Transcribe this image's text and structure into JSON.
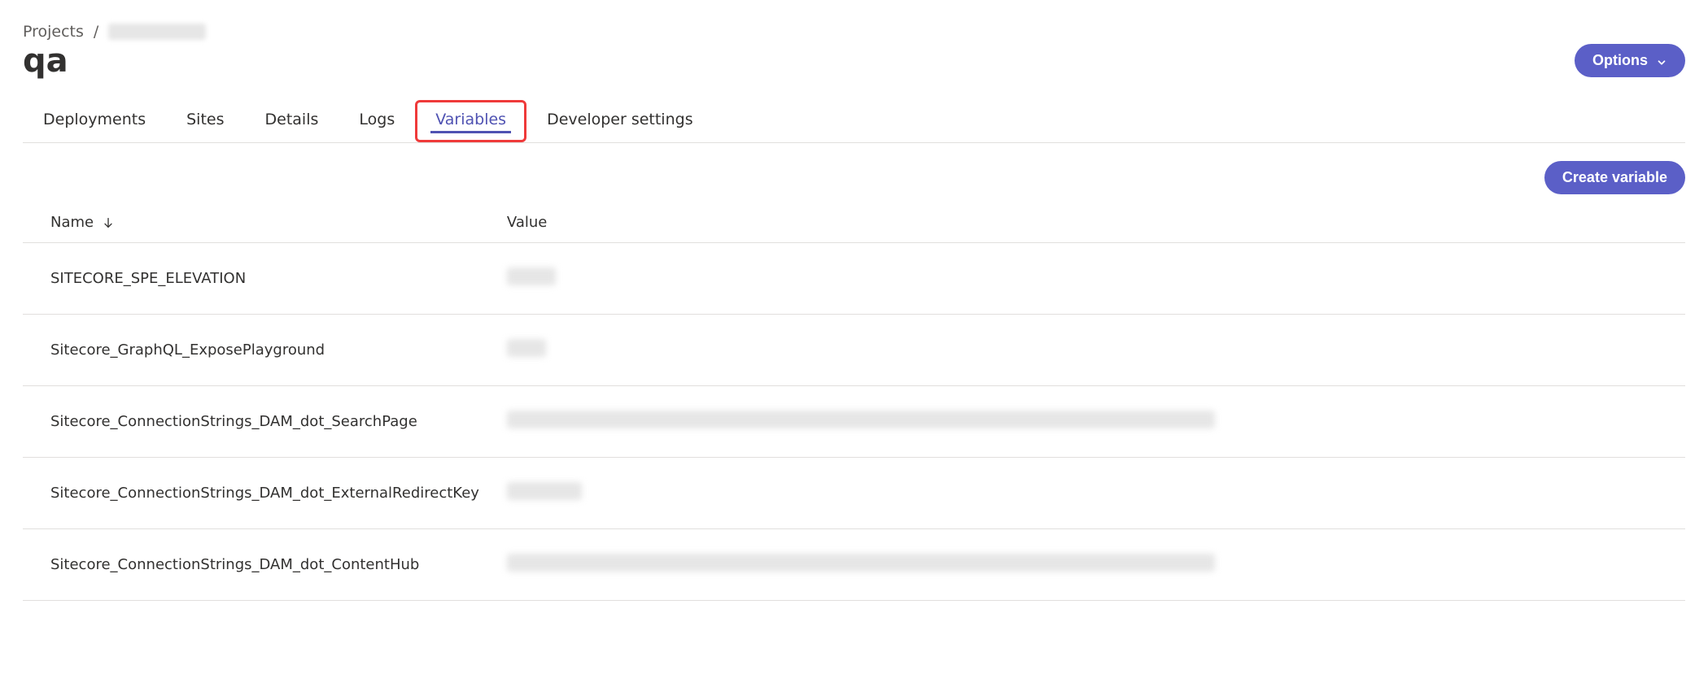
{
  "breadcrumb": {
    "root": "Projects",
    "separator": "/",
    "current_redacted": true
  },
  "page_title": "qa",
  "options_button": "Options",
  "tabs": [
    {
      "id": "deployments",
      "label": "Deployments",
      "active": false,
      "highlighted": false
    },
    {
      "id": "sites",
      "label": "Sites",
      "active": false,
      "highlighted": false
    },
    {
      "id": "details",
      "label": "Details",
      "active": false,
      "highlighted": false
    },
    {
      "id": "logs",
      "label": "Logs",
      "active": false,
      "highlighted": false
    },
    {
      "id": "variables",
      "label": "Variables",
      "active": true,
      "highlighted": true
    },
    {
      "id": "dev-settings",
      "label": "Developer settings",
      "active": false,
      "highlighted": false
    }
  ],
  "create_button": "Create variable",
  "table": {
    "columns": {
      "name": "Name",
      "value": "Value"
    },
    "sort": {
      "column": "name",
      "direction": "asc"
    },
    "rows": [
      {
        "name": "SITECORE_SPE_ELEVATION",
        "value_redacted": true,
        "value_width": 60
      },
      {
        "name": "Sitecore_GraphQL_ExposePlayground",
        "value_redacted": true,
        "value_width": 48
      },
      {
        "name": "Sitecore_ConnectionStrings_DAM_dot_SearchPage",
        "value_redacted": true,
        "value_width": 870
      },
      {
        "name": "Sitecore_ConnectionStrings_DAM_dot_ExternalRedirectKey",
        "value_redacted": true,
        "value_width": 92
      },
      {
        "name": "Sitecore_ConnectionStrings_DAM_dot_ContentHub",
        "value_redacted": true,
        "value_width": 870
      }
    ]
  }
}
